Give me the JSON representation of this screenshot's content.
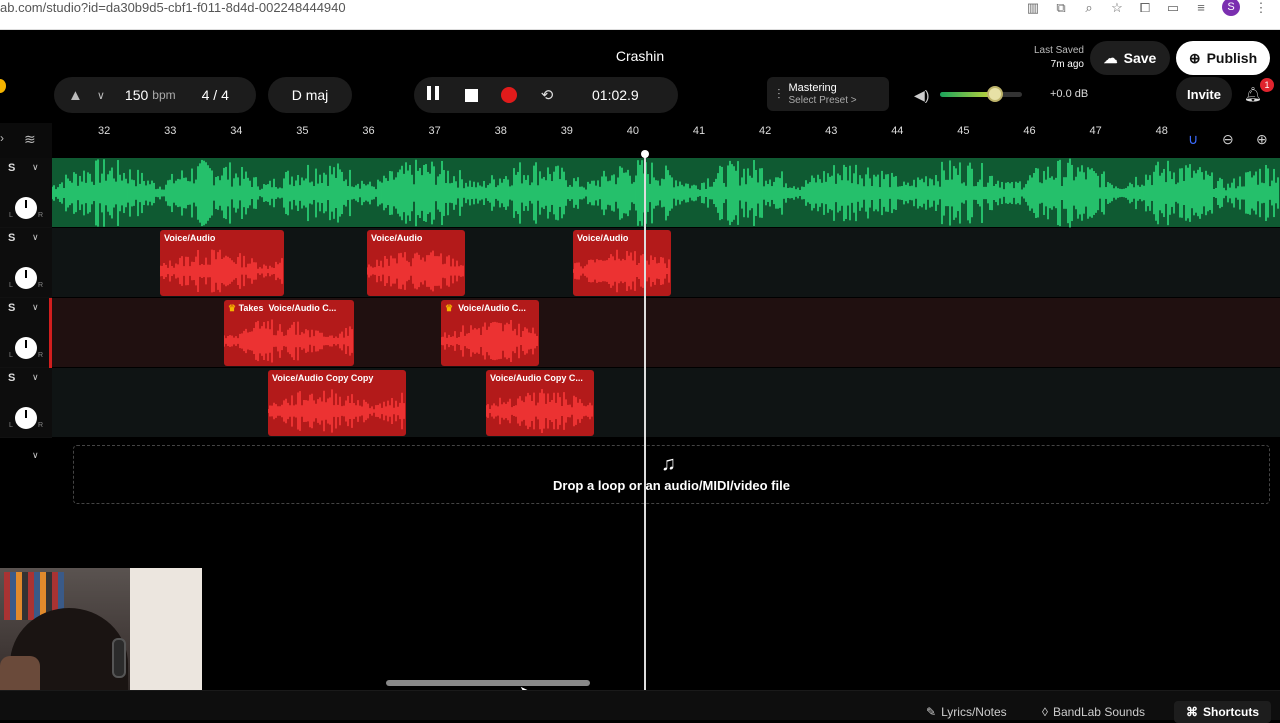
{
  "browser": {
    "url": "ab.com/studio?id=da30b9d5-cbf1-f011-8d4d-002248444940",
    "profile_initial": "S"
  },
  "header": {
    "project_title": "Crashin",
    "last_saved_label": "Last Saved",
    "last_saved_time": "7m ago",
    "save_label": "Save",
    "publish_label": "Publish",
    "invite_label": "Invite",
    "notification_count": "1"
  },
  "toolbar": {
    "bpm_value": "150",
    "bpm_unit": "bpm",
    "time_signature": "4 / 4",
    "key": "D maj",
    "time_display": "01:02.9",
    "mastering_title": "Mastering",
    "mastering_preset": "Select Preset >",
    "volume_db": "+0.0 dB",
    "volume_level": 0.67
  },
  "ruler": {
    "bars": [
      "32",
      "33",
      "34",
      "35",
      "36",
      "37",
      "38",
      "39",
      "40",
      "41",
      "42",
      "43",
      "44",
      "45",
      "46",
      "47",
      "48"
    ]
  },
  "tracks": [
    {
      "solo_label": "S",
      "color": "#1ec66d",
      "clips": []
    },
    {
      "solo_label": "S",
      "color": "#c41d1d",
      "clips": [
        {
          "label": "Voice/Audio"
        },
        {
          "label": "Voice/Audio"
        },
        {
          "label": "Voice/Audio"
        }
      ]
    },
    {
      "solo_label": "S",
      "color": "#c41d1d",
      "selected": true,
      "clips": [
        {
          "label": "Voice/Audio C...",
          "takes_label": "Takes"
        },
        {
          "label": "Voice/Audio C..."
        }
      ]
    },
    {
      "solo_label": "S",
      "color": "#c41d1d",
      "clips": [
        {
          "label": "Voice/Audio Copy Copy"
        },
        {
          "label": "Voice/Audio Copy C..."
        }
      ]
    }
  ],
  "dropzone": {
    "text": "Drop a loop or an audio/MIDI/video file"
  },
  "footer": {
    "lyrics_label": "Lyrics/Notes",
    "sounds_label": "BandLab Sounds",
    "shortcuts_label": "Shortcuts"
  },
  "icons": {
    "metronome": "metronome-icon",
    "pause": "pause-icon",
    "stop": "stop-icon",
    "record": "record-icon",
    "loop": "loop-icon",
    "speaker": "speaker-icon",
    "bell": "bell-icon",
    "magnet": "magnet-icon"
  }
}
